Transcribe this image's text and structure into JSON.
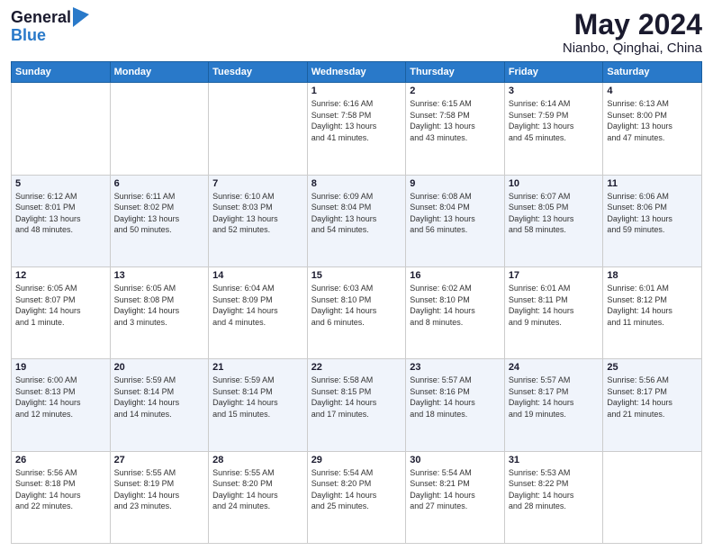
{
  "logo": {
    "general": "General",
    "blue": "Blue"
  },
  "title": {
    "month": "May 2024",
    "location": "Nianbo, Qinghai, China"
  },
  "weekdays": [
    "Sunday",
    "Monday",
    "Tuesday",
    "Wednesday",
    "Thursday",
    "Friday",
    "Saturday"
  ],
  "weeks": [
    [
      {
        "day": "",
        "info": ""
      },
      {
        "day": "",
        "info": ""
      },
      {
        "day": "",
        "info": ""
      },
      {
        "day": "1",
        "info": "Sunrise: 6:16 AM\nSunset: 7:58 PM\nDaylight: 13 hours\nand 41 minutes."
      },
      {
        "day": "2",
        "info": "Sunrise: 6:15 AM\nSunset: 7:58 PM\nDaylight: 13 hours\nand 43 minutes."
      },
      {
        "day": "3",
        "info": "Sunrise: 6:14 AM\nSunset: 7:59 PM\nDaylight: 13 hours\nand 45 minutes."
      },
      {
        "day": "4",
        "info": "Sunrise: 6:13 AM\nSunset: 8:00 PM\nDaylight: 13 hours\nand 47 minutes."
      }
    ],
    [
      {
        "day": "5",
        "info": "Sunrise: 6:12 AM\nSunset: 8:01 PM\nDaylight: 13 hours\nand 48 minutes."
      },
      {
        "day": "6",
        "info": "Sunrise: 6:11 AM\nSunset: 8:02 PM\nDaylight: 13 hours\nand 50 minutes."
      },
      {
        "day": "7",
        "info": "Sunrise: 6:10 AM\nSunset: 8:03 PM\nDaylight: 13 hours\nand 52 minutes."
      },
      {
        "day": "8",
        "info": "Sunrise: 6:09 AM\nSunset: 8:04 PM\nDaylight: 13 hours\nand 54 minutes."
      },
      {
        "day": "9",
        "info": "Sunrise: 6:08 AM\nSunset: 8:04 PM\nDaylight: 13 hours\nand 56 minutes."
      },
      {
        "day": "10",
        "info": "Sunrise: 6:07 AM\nSunset: 8:05 PM\nDaylight: 13 hours\nand 58 minutes."
      },
      {
        "day": "11",
        "info": "Sunrise: 6:06 AM\nSunset: 8:06 PM\nDaylight: 13 hours\nand 59 minutes."
      }
    ],
    [
      {
        "day": "12",
        "info": "Sunrise: 6:05 AM\nSunset: 8:07 PM\nDaylight: 14 hours\nand 1 minute."
      },
      {
        "day": "13",
        "info": "Sunrise: 6:05 AM\nSunset: 8:08 PM\nDaylight: 14 hours\nand 3 minutes."
      },
      {
        "day": "14",
        "info": "Sunrise: 6:04 AM\nSunset: 8:09 PM\nDaylight: 14 hours\nand 4 minutes."
      },
      {
        "day": "15",
        "info": "Sunrise: 6:03 AM\nSunset: 8:10 PM\nDaylight: 14 hours\nand 6 minutes."
      },
      {
        "day": "16",
        "info": "Sunrise: 6:02 AM\nSunset: 8:10 PM\nDaylight: 14 hours\nand 8 minutes."
      },
      {
        "day": "17",
        "info": "Sunrise: 6:01 AM\nSunset: 8:11 PM\nDaylight: 14 hours\nand 9 minutes."
      },
      {
        "day": "18",
        "info": "Sunrise: 6:01 AM\nSunset: 8:12 PM\nDaylight: 14 hours\nand 11 minutes."
      }
    ],
    [
      {
        "day": "19",
        "info": "Sunrise: 6:00 AM\nSunset: 8:13 PM\nDaylight: 14 hours\nand 12 minutes."
      },
      {
        "day": "20",
        "info": "Sunrise: 5:59 AM\nSunset: 8:14 PM\nDaylight: 14 hours\nand 14 minutes."
      },
      {
        "day": "21",
        "info": "Sunrise: 5:59 AM\nSunset: 8:14 PM\nDaylight: 14 hours\nand 15 minutes."
      },
      {
        "day": "22",
        "info": "Sunrise: 5:58 AM\nSunset: 8:15 PM\nDaylight: 14 hours\nand 17 minutes."
      },
      {
        "day": "23",
        "info": "Sunrise: 5:57 AM\nSunset: 8:16 PM\nDaylight: 14 hours\nand 18 minutes."
      },
      {
        "day": "24",
        "info": "Sunrise: 5:57 AM\nSunset: 8:17 PM\nDaylight: 14 hours\nand 19 minutes."
      },
      {
        "day": "25",
        "info": "Sunrise: 5:56 AM\nSunset: 8:17 PM\nDaylight: 14 hours\nand 21 minutes."
      }
    ],
    [
      {
        "day": "26",
        "info": "Sunrise: 5:56 AM\nSunset: 8:18 PM\nDaylight: 14 hours\nand 22 minutes."
      },
      {
        "day": "27",
        "info": "Sunrise: 5:55 AM\nSunset: 8:19 PM\nDaylight: 14 hours\nand 23 minutes."
      },
      {
        "day": "28",
        "info": "Sunrise: 5:55 AM\nSunset: 8:20 PM\nDaylight: 14 hours\nand 24 minutes."
      },
      {
        "day": "29",
        "info": "Sunrise: 5:54 AM\nSunset: 8:20 PM\nDaylight: 14 hours\nand 25 minutes."
      },
      {
        "day": "30",
        "info": "Sunrise: 5:54 AM\nSunset: 8:21 PM\nDaylight: 14 hours\nand 27 minutes."
      },
      {
        "day": "31",
        "info": "Sunrise: 5:53 AM\nSunset: 8:22 PM\nDaylight: 14 hours\nand 28 minutes."
      },
      {
        "day": "",
        "info": ""
      }
    ]
  ]
}
